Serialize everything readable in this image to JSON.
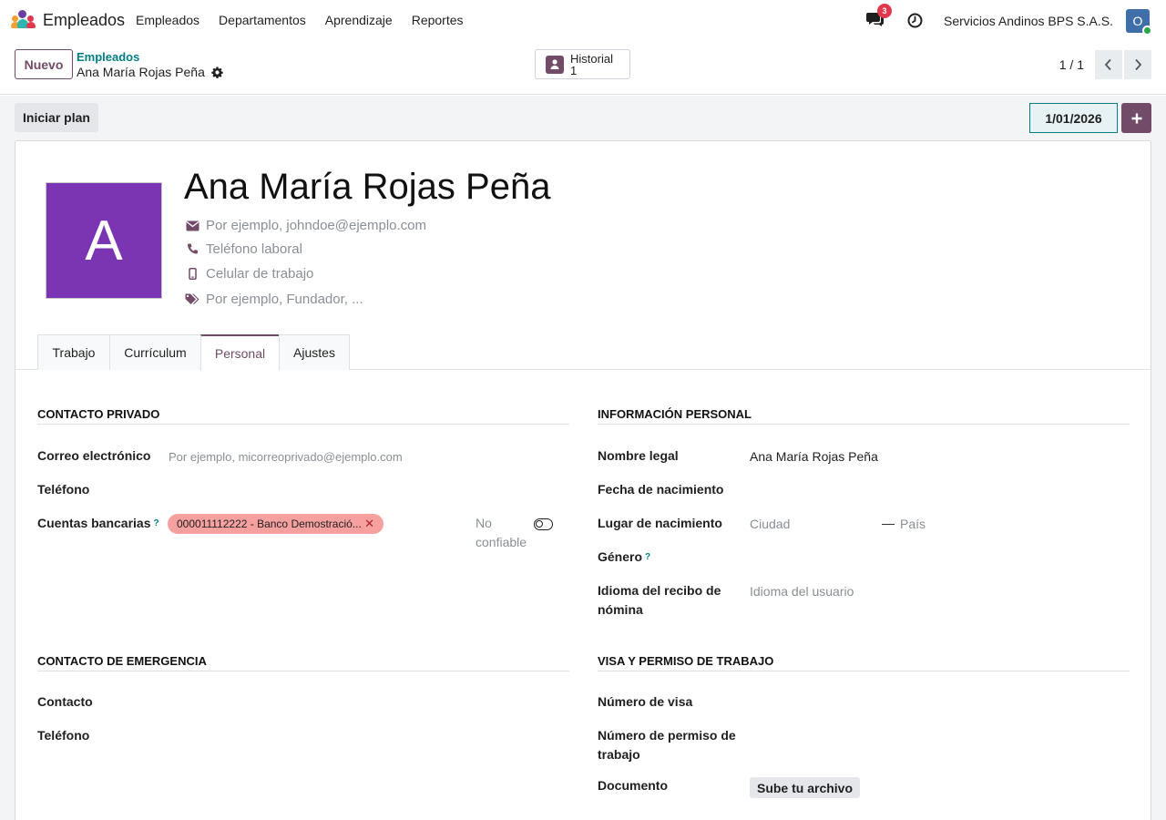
{
  "app": {
    "title": "Empleados",
    "logo_icon": "employees-app-icon",
    "menu": [
      "Empleados",
      "Departamentos",
      "Aprendizaje",
      "Reportes"
    ],
    "messages_badge": "3",
    "company": "Servicios Andinos BPS S.A.S.",
    "user_initial": "O"
  },
  "control": {
    "new_label": "Nuevo",
    "breadcrumb_parent": "Empleados",
    "breadcrumb_current": "Ana María Rojas Peña",
    "history_label": "Historial",
    "history_count": "1",
    "pager": "1 / 1"
  },
  "status": {
    "start_plan_label": "Iniciar plan",
    "date": "1/01/2026"
  },
  "employee": {
    "avatar_letter": "A",
    "avatar_color": "#7b35b3",
    "name": "Ana María Rojas Peña",
    "email_placeholder": "Por ejemplo, johndoe@ejemplo.com",
    "work_phone_placeholder": "Teléfono laboral",
    "mobile_placeholder": "Celular de trabajo",
    "tags_placeholder": "Por ejemplo, Fundador, ..."
  },
  "tabs": [
    {
      "label": "Trabajo"
    },
    {
      "label": "Currículum"
    },
    {
      "label": "Personal",
      "active": true
    },
    {
      "label": "Ajustes"
    }
  ],
  "private_contact": {
    "title": "CONTACTO PRIVADO",
    "email_label": "Correo electrónico",
    "email_placeholder": "Por ejemplo, micorreoprivado@ejemplo.com",
    "phone_label": "Teléfono",
    "bank_label": "Cuentas bancarias",
    "bank_help": "?",
    "bank_tag": "000011112222 - Banco Demostració...",
    "trust_label_1": "No",
    "trust_label_2": "confiable"
  },
  "personal_info": {
    "title": "INFORMACIÓN PERSONAL",
    "legal_name_label": "Nombre legal",
    "legal_name": "Ana María Rojas Peña",
    "birthday_label": "Fecha de nacimiento",
    "birthplace_label": "Lugar de nacimiento",
    "city_placeholder": "Ciudad",
    "country_placeholder": "País",
    "gender_label": "Género",
    "gender_help": "?",
    "payslip_lang_label_1": "Idioma del recibo de",
    "payslip_lang_label_2": "nómina",
    "payslip_lang_placeholder": "Idioma del usuario"
  },
  "emergency": {
    "title": "CONTACTO DE EMERGENCIA",
    "contact_label": "Contacto",
    "phone_label": "Teléfono"
  },
  "visa": {
    "title": "VISA Y PERMISO DE TRABAJO",
    "visa_label": "Número de visa",
    "permit_label_1": "Número de permiso de",
    "permit_label_2": "trabajo",
    "document_label": "Documento",
    "upload_label": "Sube tu archivo"
  }
}
